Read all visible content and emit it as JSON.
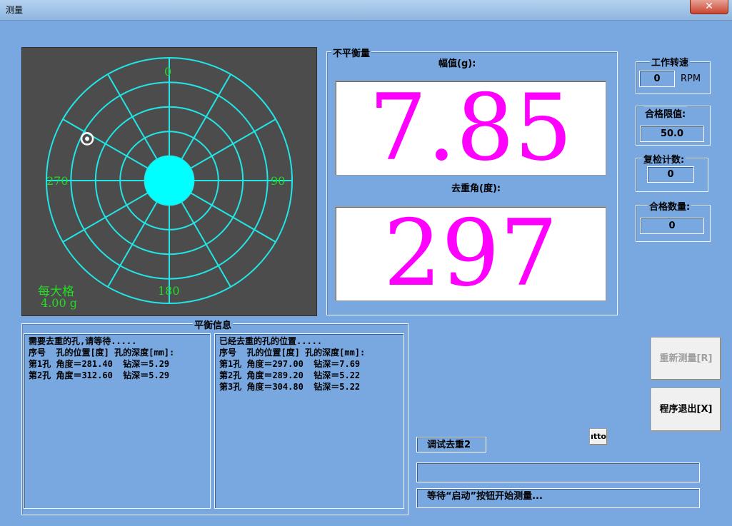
{
  "window": {
    "title": "测量",
    "close": "✕"
  },
  "polar": {
    "angle_labels": {
      "top": "0",
      "right": "90",
      "bottom": "180",
      "left": "270"
    },
    "scale_label": "每大格",
    "scale_value": "4.00 g",
    "marker_angle_deg": 297,
    "colors": {
      "grid": "#22e6e6",
      "bg": "#4c4c4c",
      "label": "#22dd22"
    }
  },
  "unbalance": {
    "group_title": "不平衡量",
    "amplitude_label": "幅值(g):",
    "amplitude_value": "7.85",
    "angle_label": "去重角(度):",
    "angle_value": "297",
    "value_color": "#ff00ff"
  },
  "side": {
    "speed_title": "工作转速",
    "speed_value": "0",
    "speed_unit": "RPM",
    "limit_title": "合格限值:",
    "limit_value": "50.0",
    "recheck_title": "复检计数:",
    "recheck_value": "0",
    "pass_title": "合格数量:",
    "pass_value": "0"
  },
  "balance_info": {
    "group_title": "平衡信息",
    "pending": "需要去重的孔,请等待.....\n序号  孔的位置[度] 孔的深度[mm]:\n第1孔 角度＝281.40  钻深＝5.29\n第2孔 角度＝312.60  钻深＝5.29",
    "done": "已经去重的孔的位置.....\n序号  孔的位置[度] 孔的深度[mm]:\n第1孔 角度＝297.00  钻深＝7.69\n第2孔 角度＝289.20  钻深＝5.22\n第3孔 角度＝304.80  钻深＝5.22"
  },
  "buttons": {
    "remeasure": "重新测量[R]",
    "exit": "程序退出[X]",
    "auto": "ıtto"
  },
  "status": {
    "debug_label": "调试去重2",
    "line1": "",
    "line2": "等待“启动”按钮开始测量..."
  }
}
